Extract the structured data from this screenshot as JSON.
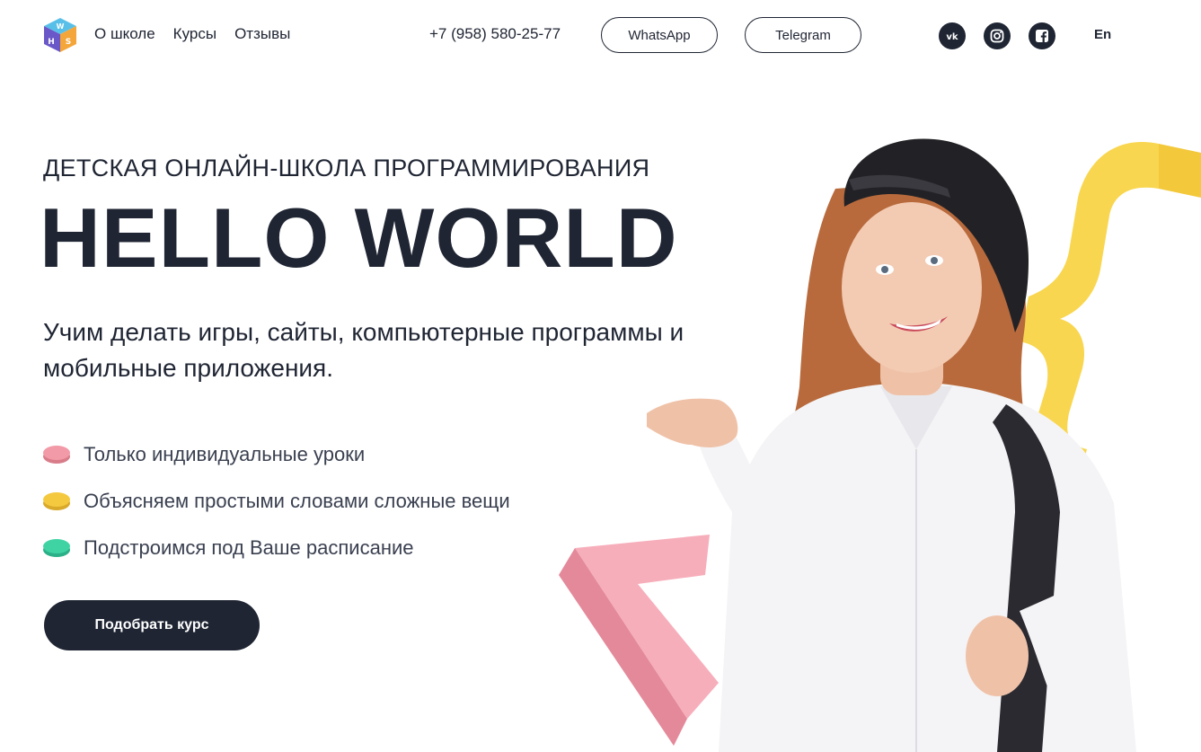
{
  "header": {
    "nav": [
      "О школе",
      "Курсы",
      "Отзывы"
    ],
    "phone": "+7 (958) 580-25-77",
    "whatsapp_label": "WhatsApp",
    "telegram_label": "Telegram",
    "social_icons": [
      "vk-icon",
      "instagram-icon",
      "facebook-icon"
    ],
    "lang_label": "En"
  },
  "hero": {
    "kicker": "ДЕТСКАЯ ОНЛАЙН-ШКОЛА ПРОГРАММИРОВАНИЯ",
    "title": "HELLO WORLD",
    "subtitle": "Учим делать игры, сайты, компьютерные программы и мобильные приложения.",
    "features": [
      {
        "text": "Только индивидуальные уроки",
        "color": "#f29aa7"
      },
      {
        "text": "Объясняем простыми словами сложные вещи",
        "color": "#f4c93f"
      },
      {
        "text": "Подстроимся под Ваше расписание",
        "color": "#3fd3a3"
      }
    ],
    "cta_label": "Подобрать курс"
  },
  "colors": {
    "primary": "#1f2533",
    "pink_shape": "#f7aebb",
    "yellow_shape": "#f9d64f"
  }
}
